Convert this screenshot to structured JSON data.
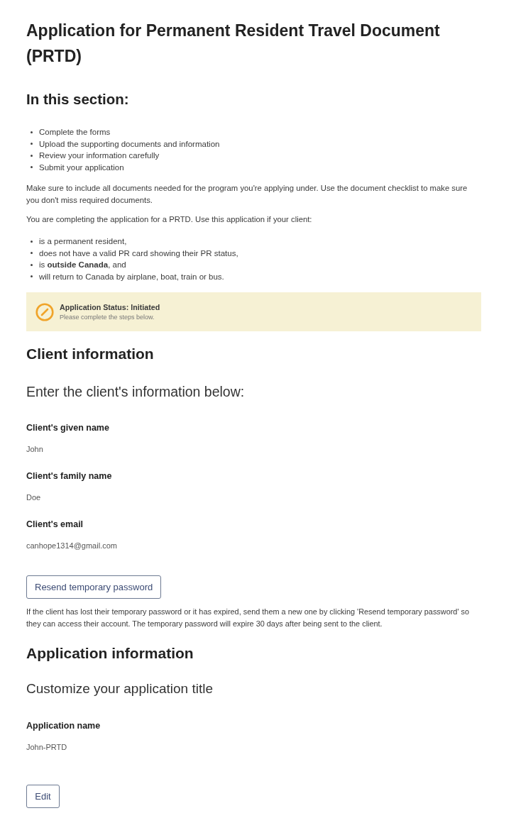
{
  "page": {
    "title": "Application for Permanent Resident Travel Document (PRTD)"
  },
  "intro": {
    "heading": "In this section:",
    "steps": [
      "Complete the forms",
      "Upload the supporting documents and information",
      "Review your information carefully",
      "Submit your application"
    ],
    "paragraphs": [
      "Make sure to include all documents needed for the program you're applying under. Use the document checklist to make sure you don't miss required documents.",
      "You are completing the application for a PRTD. Use this application if your client:"
    ],
    "criteria": [
      "is a permanent resident,",
      "does not have a valid PR card showing their PR status,",
      "is **outside Canada**, and",
      "will return to Canada by airplane, boat, train or bus."
    ]
  },
  "status_banner": {
    "title": "Application Status: Initiated",
    "message": "Please complete the steps below."
  },
  "client_information": {
    "heading": "Client information",
    "subheading": "Enter the client's information below:",
    "fields": [
      {
        "label": "Client's given name",
        "value": "John"
      },
      {
        "label": "Client's family name",
        "value": "Doe"
      },
      {
        "label": "Client's email",
        "value": "canhope1314@gmail.com"
      }
    ],
    "button": "Resend temporary password",
    "note": "If the client has lost their temporary password or it has expired, send them a new one by clicking 'Resend temporary password' so they can access their account. The temporary password will expire 30 days after being sent to the client."
  },
  "application_information": {
    "heading": "Application information",
    "subheading": "Customize your application title",
    "fields": [
      {
        "label": "Application name",
        "value": "John-PRTD"
      }
    ],
    "button": "Edit"
  }
}
